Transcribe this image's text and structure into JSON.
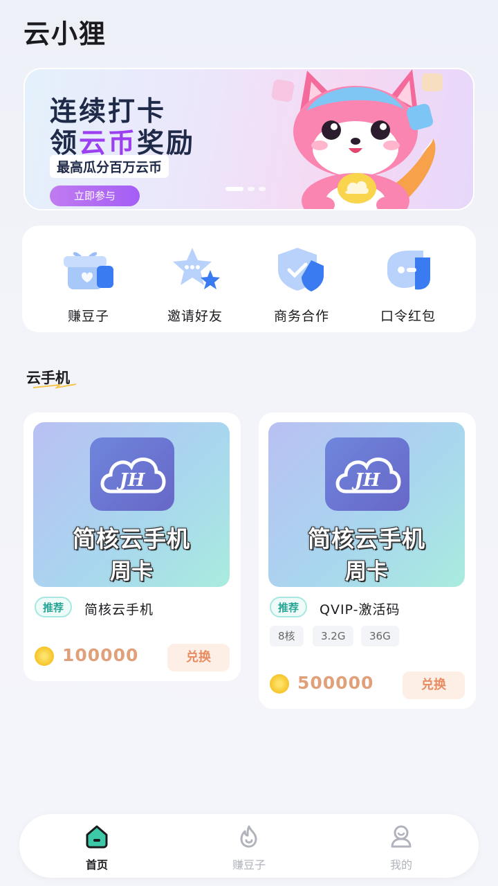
{
  "app": {
    "title": "云小狸"
  },
  "banner": {
    "line1": "连续打卡",
    "line2_prefix": "领",
    "line2_highlight": "云币",
    "line2_suffix": "奖励",
    "subtitle": "最高瓜分百万云币",
    "button": "立即参与"
  },
  "quick_actions": [
    {
      "label": "赚豆子",
      "icon": "gift-box-icon"
    },
    {
      "label": "邀请好友",
      "icon": "star-chat-icon"
    },
    {
      "label": "商务合作",
      "icon": "shield-check-icon"
    },
    {
      "label": "口令红包",
      "icon": "red-packet-icon"
    }
  ],
  "section": {
    "title": "云手机"
  },
  "products": [
    {
      "image_title": "简核云手机",
      "image_sub": "周卡",
      "logo_text": "JH",
      "tag": "推荐",
      "name": "简核云手机",
      "specs": [],
      "price": "100000",
      "action": "兑换"
    },
    {
      "image_title": "简核云手机",
      "image_sub": "周卡",
      "logo_text": "JH",
      "tag": "推荐",
      "name": "QVIP-激活码",
      "specs": [
        "8核",
        "3.2G",
        "36G"
      ],
      "price": "500000",
      "action": "兑换"
    }
  ],
  "nav": {
    "items": [
      {
        "label": "首页",
        "icon": "home-icon",
        "active": true
      },
      {
        "label": "赚豆子",
        "icon": "flame-icon",
        "active": false
      },
      {
        "label": "我的",
        "icon": "user-icon",
        "active": false
      }
    ]
  },
  "colors": {
    "accent_purple": "#9b3ff0",
    "tag_teal": "#29a596",
    "price_orange": "#e0a07a",
    "button_bg": "#fdefe6"
  }
}
